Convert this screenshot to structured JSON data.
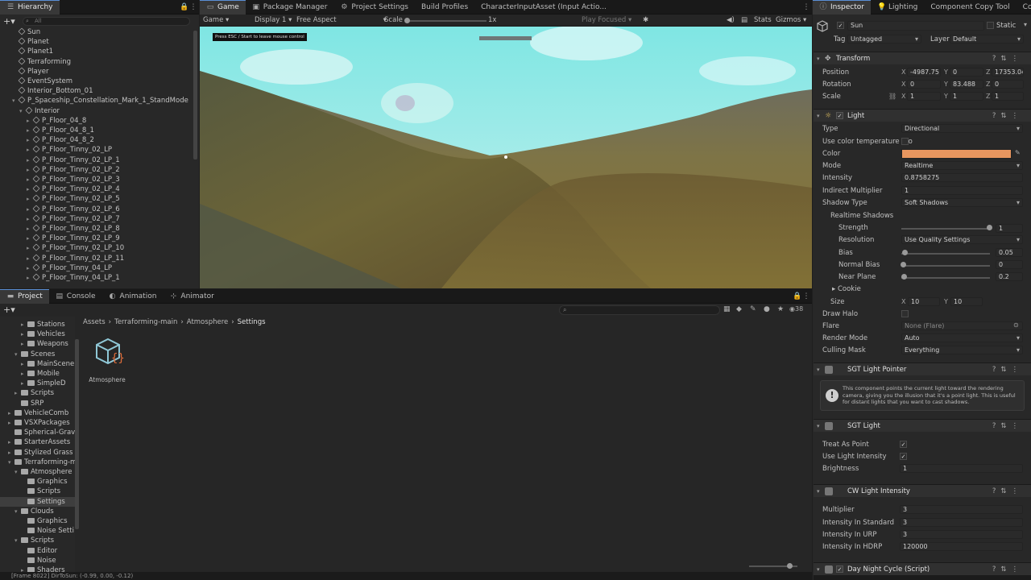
{
  "hierarchy": {
    "tab": "Hierarchy",
    "search_placeholder": "All",
    "items": [
      {
        "label": "Sun",
        "depth": 1,
        "kind": "go",
        "fold": ""
      },
      {
        "label": "Planet",
        "depth": 1,
        "kind": "go",
        "fold": ""
      },
      {
        "label": "Planet1",
        "depth": 1,
        "kind": "go",
        "fold": ""
      },
      {
        "label": "Terraforming",
        "depth": 1,
        "kind": "go",
        "fold": ""
      },
      {
        "label": "Player",
        "depth": 1,
        "kind": "go",
        "fold": ""
      },
      {
        "label": "EventSystem",
        "depth": 1,
        "kind": "go",
        "fold": ""
      },
      {
        "label": "Interior_Bottom_01",
        "depth": 1,
        "kind": "go",
        "fold": ""
      },
      {
        "label": "P_Spaceship_Constellation_Mark_1_StandMode",
        "depth": 1,
        "kind": "go",
        "fold": "open"
      },
      {
        "label": "Interior",
        "depth": 2,
        "kind": "go",
        "fold": "open"
      },
      {
        "label": "P_Floor_04_8",
        "depth": 3,
        "kind": "go",
        "fold": "closed"
      },
      {
        "label": "P_Floor_04_8_1",
        "depth": 3,
        "kind": "go",
        "fold": "closed"
      },
      {
        "label": "P_Floor_04_8_2",
        "depth": 3,
        "kind": "go",
        "fold": "closed"
      },
      {
        "label": "P_Floor_Tinny_02_LP",
        "depth": 3,
        "kind": "go",
        "fold": "closed"
      },
      {
        "label": "P_Floor_Tinny_02_LP_1",
        "depth": 3,
        "kind": "go",
        "fold": "closed"
      },
      {
        "label": "P_Floor_Tinny_02_LP_2",
        "depth": 3,
        "kind": "go",
        "fold": "closed"
      },
      {
        "label": "P_Floor_Tinny_02_LP_3",
        "depth": 3,
        "kind": "go",
        "fold": "closed"
      },
      {
        "label": "P_Floor_Tinny_02_LP_4",
        "depth": 3,
        "kind": "go",
        "fold": "closed"
      },
      {
        "label": "P_Floor_Tinny_02_LP_5",
        "depth": 3,
        "kind": "go",
        "fold": "closed"
      },
      {
        "label": "P_Floor_Tinny_02_LP_6",
        "depth": 3,
        "kind": "go",
        "fold": "closed"
      },
      {
        "label": "P_Floor_Tinny_02_LP_7",
        "depth": 3,
        "kind": "go",
        "fold": "closed"
      },
      {
        "label": "P_Floor_Tinny_02_LP_8",
        "depth": 3,
        "kind": "go",
        "fold": "closed"
      },
      {
        "label": "P_Floor_Tinny_02_LP_9",
        "depth": 3,
        "kind": "go",
        "fold": "closed"
      },
      {
        "label": "P_Floor_Tinny_02_LP_10",
        "depth": 3,
        "kind": "go",
        "fold": "closed"
      },
      {
        "label": "P_Floor_Tinny_02_LP_11",
        "depth": 3,
        "kind": "go",
        "fold": "closed"
      },
      {
        "label": "P_Floor_Tinny_04_LP",
        "depth": 3,
        "kind": "go",
        "fold": "closed"
      },
      {
        "label": "P_Floor_Tinny_04_LP_1",
        "depth": 3,
        "kind": "go",
        "fold": "closed"
      }
    ]
  },
  "center_tabs": [
    "Game",
    "Package Manager",
    "Project Settings",
    "Build Profiles",
    "CharacterInputAsset (Input Actio..."
  ],
  "game_toolbar": {
    "mode": "Game",
    "display": "Display 1",
    "aspect": "Free Aspect",
    "scale_label": "Scale",
    "scale_value": "1x",
    "play_focused": "Play Focused",
    "stats": "Stats",
    "gizmos": "Gizmos"
  },
  "game_overlay": "Press ESC / Start to leave mouse control",
  "bottom_tabs": [
    "Project",
    "Console",
    "Animation",
    "Animator"
  ],
  "project": {
    "breadcrumb": [
      "Assets",
      "Terraforming-main",
      "Atmosphere",
      "Settings"
    ],
    "asset": {
      "label": "Atmosphere"
    },
    "count": "38",
    "folders": [
      {
        "label": "Stations",
        "depth": 3,
        "fold": "closed"
      },
      {
        "label": "Vehicles",
        "depth": 3,
        "fold": "closed"
      },
      {
        "label": "Weapons",
        "depth": 3,
        "fold": "closed"
      },
      {
        "label": "Scenes",
        "depth": 2,
        "fold": "open"
      },
      {
        "label": "MainScene",
        "depth": 3,
        "fold": "closed"
      },
      {
        "label": "Mobile",
        "depth": 3,
        "fold": "closed"
      },
      {
        "label": "SimpleD",
        "depth": 3,
        "fold": "closed"
      },
      {
        "label": "Scripts",
        "depth": 2,
        "fold": "closed"
      },
      {
        "label": "SRP",
        "depth": 2,
        "fold": ""
      },
      {
        "label": "VehicleComb",
        "depth": 1,
        "fold": "closed"
      },
      {
        "label": "VSXPackages",
        "depth": 1,
        "fold": "closed"
      },
      {
        "label": "Spherical-Gravi",
        "depth": 1,
        "fold": ""
      },
      {
        "label": "StarterAssets",
        "depth": 1,
        "fold": "closed"
      },
      {
        "label": "Stylized Grass S",
        "depth": 1,
        "fold": "closed"
      },
      {
        "label": "Terraforming-m",
        "depth": 1,
        "fold": "open"
      },
      {
        "label": "Atmosphere",
        "depth": 2,
        "fold": "open"
      },
      {
        "label": "Graphics",
        "depth": 3,
        "fold": ""
      },
      {
        "label": "Scripts",
        "depth": 3,
        "fold": ""
      },
      {
        "label": "Settings",
        "depth": 3,
        "fold": "",
        "selected": true
      },
      {
        "label": "Clouds",
        "depth": 2,
        "fold": "open"
      },
      {
        "label": "Graphics",
        "depth": 3,
        "fold": ""
      },
      {
        "label": "Noise Setti",
        "depth": 3,
        "fold": ""
      },
      {
        "label": "Scripts",
        "depth": 2,
        "fold": "open"
      },
      {
        "label": "Editor",
        "depth": 3,
        "fold": ""
      },
      {
        "label": "Noise",
        "depth": 3,
        "fold": ""
      },
      {
        "label": "Shaders",
        "depth": 3,
        "fold": "closed"
      }
    ]
  },
  "status_bar": "[Frame 8022] DirToSun: (-0.99, 0.00, -0.12)",
  "inspector_tabs": [
    "Inspector",
    "Lighting",
    "Component Copy Tool",
    "Col"
  ],
  "inspector": {
    "name": "Sun",
    "static": "Static",
    "tag_label": "Tag",
    "tag": "Untagged",
    "layer_label": "Layer",
    "layer": "Default",
    "transform": {
      "title": "Transform",
      "position_label": "Position",
      "px": "-4987.75",
      "py": "0",
      "pz": "17353.04",
      "rotation_label": "Rotation",
      "rx": "0",
      "ry": "83.488",
      "rz": "0",
      "scale_label": "Scale",
      "sx": "1",
      "sy": "1",
      "sz": "1"
    },
    "light": {
      "title": "Light",
      "rows": [
        {
          "label": "Type",
          "value": "Directional",
          "kind": "dd"
        },
        {
          "label": "Use color temperature mo",
          "value": "",
          "kind": "chk"
        },
        {
          "label": "Color",
          "value": "",
          "kind": "color"
        },
        {
          "label": "Mode",
          "value": "Realtime",
          "kind": "dd"
        },
        {
          "label": "Intensity",
          "value": "0.8758275",
          "kind": "field"
        },
        {
          "label": "Indirect Multiplier",
          "value": "1",
          "kind": "field"
        },
        {
          "label": "Shadow Type",
          "value": "Soft Shadows",
          "kind": "dd"
        }
      ],
      "realtime_shadows": "Realtime Shadows",
      "strength_label": "Strength",
      "strength": "1",
      "resolution_label": "Resolution",
      "resolution": "Use Quality Settings",
      "bias_label": "Bias",
      "bias": "0.05",
      "normal_bias_label": "Normal Bias",
      "normal_bias": "0",
      "near_plane_label": "Near Plane",
      "near_plane": "0.2",
      "cookie_label": "Cookie",
      "size_label": "Size",
      "size_x": "10",
      "size_y": "10",
      "draw_halo_label": "Draw Halo",
      "flare_label": "Flare",
      "flare": "None (Flare)",
      "render_mode_label": "Render Mode",
      "render_mode": "Auto",
      "culling_mask_label": "Culling Mask",
      "culling_mask": "Everything",
      "color": "#e8965f"
    },
    "sgt_pointer": {
      "title": "SGT Light Pointer",
      "help": "This component points the current light toward the rendering camera, giving you the illusion that it's a point light. This is useful for distant lights that you want to cast shadows."
    },
    "sgt_light": {
      "title": "SGT Light",
      "treat_label": "Treat As Point",
      "use_label": "Use Light Intensity",
      "brightness_label": "Brightness",
      "brightness": "1"
    },
    "cw_light": {
      "title": "CW Light Intensity",
      "multiplier_label": "Multiplier",
      "multiplier": "3",
      "std_label": "Intensity In Standard",
      "std": "3",
      "urp_label": "Intensity In URP",
      "urp": "3",
      "hdrp_label": "Intensity In HDRP",
      "hdrp": "120000"
    },
    "daynight": {
      "title": "Day Night Cycle (Script)"
    }
  }
}
